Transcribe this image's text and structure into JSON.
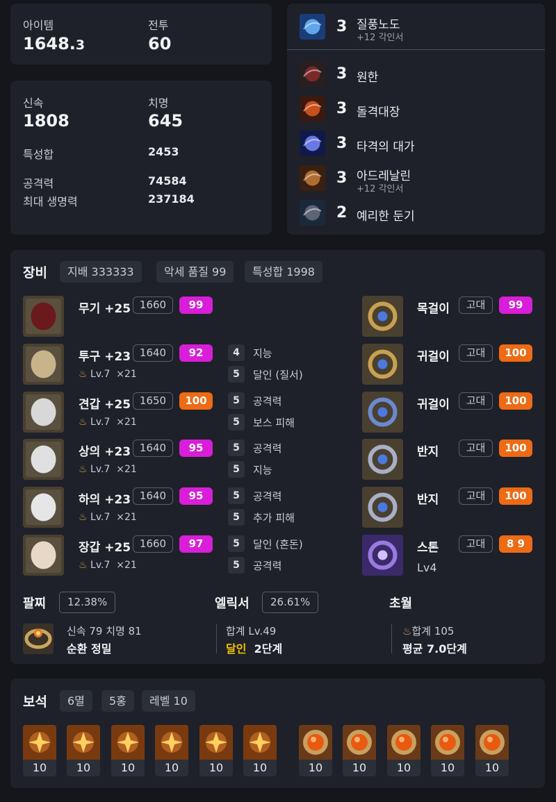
{
  "stats": {
    "item_level_label": "아이템",
    "item_level_main": "1648.",
    "item_level_frac": "3",
    "combat_label": "전투",
    "combat_value": "60",
    "swift_label": "신속",
    "swift_value": "1808",
    "crit_label": "치명",
    "crit_value": "645",
    "trait_sum_label": "특성합",
    "trait_sum_value": "2453",
    "attack_label": "공격력",
    "attack_value": "74584",
    "hp_label": "최대 생명력",
    "hp_value": "237184"
  },
  "engravings": [
    {
      "level": "3",
      "name": "질풍노도",
      "sub": "+12 각인서"
    },
    {
      "level": "3",
      "name": "원한",
      "sub": ""
    },
    {
      "level": "3",
      "name": "돌격대장",
      "sub": ""
    },
    {
      "level": "3",
      "name": "타격의 대가",
      "sub": ""
    },
    {
      "level": "3",
      "name": "아드레날린",
      "sub": "+12 각인서"
    },
    {
      "level": "2",
      "name": "예리한 둔기",
      "sub": ""
    }
  ],
  "equipment": {
    "title": "장비",
    "tags": [
      "지배 333333",
      "악세 품질 99",
      "특성합 1998"
    ],
    "armor": [
      {
        "name": "무기 +25",
        "level": "1660",
        "quality": "99",
        "color": "mag",
        "elixir_lv": "",
        "elixir_count": "",
        "effects": []
      },
      {
        "name": "투구 +23",
        "level": "1640",
        "quality": "92",
        "color": "mag",
        "elixir_lv": "Lv.7",
        "elixir_count": "×21",
        "effects": [
          {
            "n": "4",
            "t": "지능"
          },
          {
            "n": "5",
            "t": "달인 (질서)"
          }
        ]
      },
      {
        "name": "견갑 +25",
        "level": "1650",
        "quality": "100",
        "color": "org",
        "elixir_lv": "Lv.7",
        "elixir_count": "×21",
        "effects": [
          {
            "n": "5",
            "t": "공격력"
          },
          {
            "n": "5",
            "t": "보스 피해"
          }
        ]
      },
      {
        "name": "상의 +23",
        "level": "1640",
        "quality": "95",
        "color": "mag",
        "elixir_lv": "Lv.7",
        "elixir_count": "×21",
        "effects": [
          {
            "n": "5",
            "t": "공격력"
          },
          {
            "n": "5",
            "t": "지능"
          }
        ]
      },
      {
        "name": "하의 +23",
        "level": "1640",
        "quality": "95",
        "color": "mag",
        "elixir_lv": "Lv.7",
        "elixir_count": "×21",
        "effects": [
          {
            "n": "5",
            "t": "공격력"
          },
          {
            "n": "5",
            "t": "추가 피해"
          }
        ]
      },
      {
        "name": "장갑 +25",
        "level": "1660",
        "quality": "97",
        "color": "mag",
        "elixir_lv": "Lv.7",
        "elixir_count": "×21",
        "effects": [
          {
            "n": "5",
            "t": "달인 (혼돈)"
          },
          {
            "n": "5",
            "t": "공격력"
          }
        ]
      }
    ],
    "accessories": [
      {
        "name": "목걸이",
        "grade": "고대",
        "quality": "99",
        "color": "mag",
        "sub": ""
      },
      {
        "name": "귀걸이",
        "grade": "고대",
        "quality": "100",
        "color": "org",
        "sub": ""
      },
      {
        "name": "귀걸이",
        "grade": "고대",
        "quality": "100",
        "color": "org",
        "sub": ""
      },
      {
        "name": "반지",
        "grade": "고대",
        "quality": "100",
        "color": "org",
        "sub": ""
      },
      {
        "name": "반지",
        "grade": "고대",
        "quality": "100",
        "color": "org",
        "sub": ""
      },
      {
        "name": "스톤",
        "grade": "고대",
        "quality": "8 9",
        "color": "org",
        "sub": "Lv4"
      }
    ],
    "bracelet": {
      "title": "팔찌",
      "percent": "12.38%",
      "line1": "신속 79  치명 81",
      "line2": "순환  정밀"
    },
    "elixir": {
      "title": "엘릭서",
      "percent": "26.61%",
      "line1": "합계 Lv.49",
      "line2_accent": "달인",
      "line2": "2단계"
    },
    "transcend": {
      "title": "초월",
      "line1": "합계 105",
      "line2": "평균 7.0단계"
    }
  },
  "gems": {
    "title": "보석",
    "tags": [
      "6멸",
      "5홍",
      "레벨 10"
    ],
    "items": [
      "10",
      "10",
      "10",
      "10",
      "10",
      "10",
      "10",
      "10",
      "10",
      "10",
      "10"
    ]
  },
  "colors": {
    "magenta": "#d81ed8",
    "orange": "#ee6a14",
    "elixir_accent": "#f0c000"
  }
}
